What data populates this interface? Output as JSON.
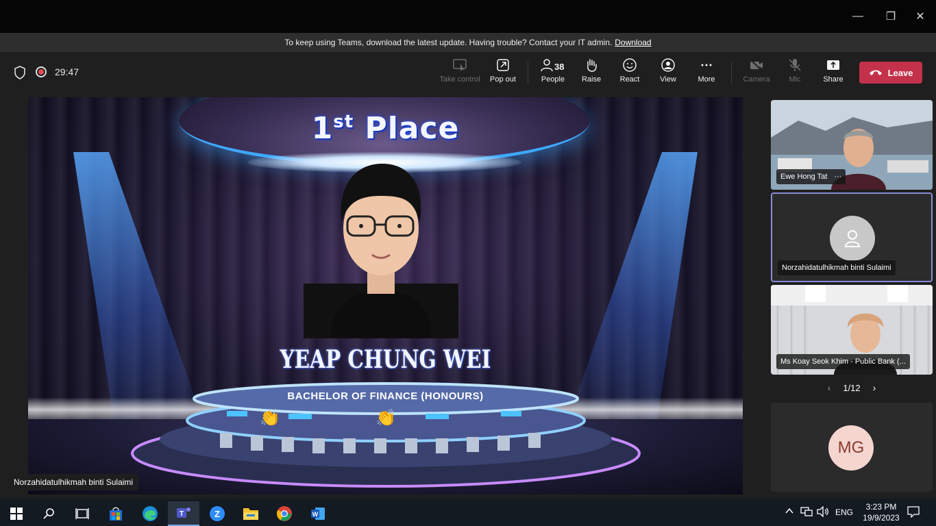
{
  "window": {
    "minimize_glyph": "—",
    "maximize_glyph": "❐",
    "close_glyph": "✕"
  },
  "banner": {
    "message": "To keep using Teams, download the latest update. Having trouble? Contact your IT admin.",
    "link": "Download"
  },
  "meeting": {
    "timer": "29:47",
    "recording_icon": "record-icon",
    "security_icon": "shield-icon"
  },
  "toolbar": {
    "take_control": "Take control",
    "pop_out": "Pop out",
    "people": "People",
    "people_count": "38",
    "raise": "Raise",
    "react": "React",
    "view": "View",
    "more": "More",
    "camera": "Camera",
    "mic": "Mic",
    "share": "Share",
    "leave": "Leave"
  },
  "stage": {
    "place_prefix": "1",
    "place_suffix": "st",
    "place_word": "Place",
    "student_name": "YEAP CHUNG WEI",
    "degree": "BACHELOR OF FINANCE (HONOURS)",
    "presenter_label": "Norzahidatulhikmah binti Sulaimi",
    "reaction_emoji": "👏"
  },
  "participants": [
    {
      "name": "Ewe Hong Tat",
      "more": "···"
    },
    {
      "name": "Norzahidatulhikmah binti Sulaimi"
    },
    {
      "name": "Ms Koay Seok Khim - Public Bank (..."
    }
  ],
  "pager": {
    "text": "1/12",
    "prev": "‹",
    "next": "›"
  },
  "overflow_tile": {
    "initials": "MG"
  },
  "taskbar": {
    "language": "ENG",
    "time": "3:23 PM",
    "date": "19/9/2023",
    "apps": [
      "start-icon",
      "search-icon",
      "task-view-icon",
      "store-icon",
      "edge-icon",
      "teams-icon",
      "zoom-icon",
      "file-explorer-icon",
      "chrome-icon",
      "word-icon"
    ]
  },
  "colors": {
    "leave": "#c4314b",
    "active_tile_border": "#8b8cd9",
    "record": "#e24a5b"
  }
}
